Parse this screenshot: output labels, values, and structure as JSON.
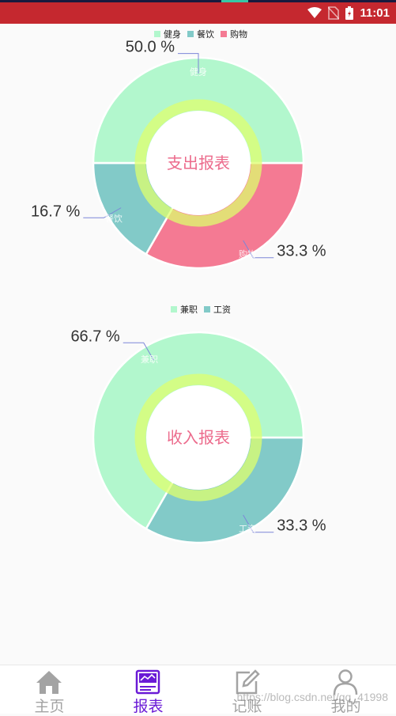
{
  "status_bar": {
    "time": "11:01"
  },
  "expense_chart": {
    "center_label": "支出报表",
    "center_color": "#ec6b8c",
    "chart_data": {
      "type": "pie",
      "categories": [
        "健身",
        "餐饮",
        "购物"
      ],
      "values": [
        50.0,
        16.7,
        33.3
      ],
      "value_labels": [
        "50.0 %",
        "16.7 %",
        "33.3 %"
      ],
      "colors": [
        "#b2f7cd",
        "#82cac8",
        "#f47a93"
      ],
      "legend_position": "top-center"
    }
  },
  "income_chart": {
    "center_label": "收入报表",
    "center_color": "#ec6b8c",
    "chart_data": {
      "type": "pie",
      "categories": [
        "兼职",
        "工资"
      ],
      "values": [
        66.7,
        33.3
      ],
      "value_labels": [
        "66.7 %",
        "33.3 %"
      ],
      "colors": [
        "#b2f7cd",
        "#82cac8"
      ],
      "legend_position": "top-center"
    }
  },
  "nav": {
    "items": [
      {
        "label": "主页",
        "icon": "home-icon",
        "active": false
      },
      {
        "label": "报表",
        "icon": "report-icon",
        "active": true
      },
      {
        "label": "记账",
        "icon": "edit-icon",
        "active": false
      },
      {
        "label": "我的",
        "icon": "user-icon",
        "active": false
      }
    ],
    "active_color": "#6a1ad6",
    "inactive_color": "#a3a3a3"
  },
  "watermark": "https://blog.csdn.net/qq_41998"
}
